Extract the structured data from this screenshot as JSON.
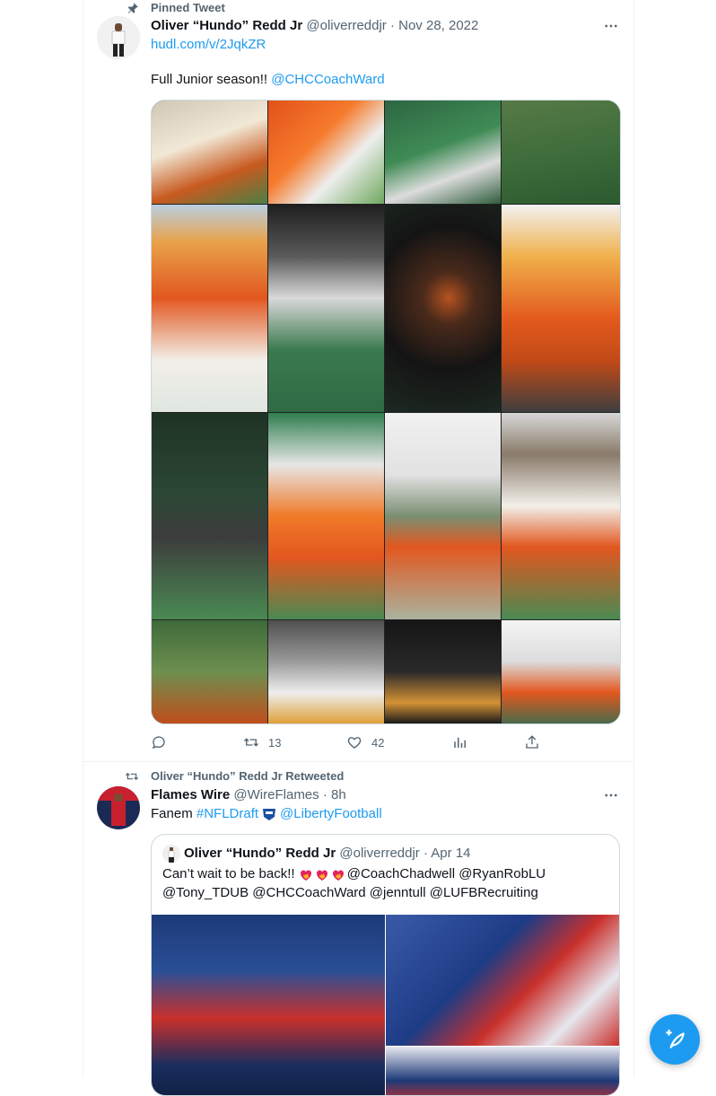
{
  "pinned_label": "Pinned Tweet",
  "tweet1": {
    "name": "Oliver “Hundo” Redd Jr",
    "handle": "@oliverreddjr",
    "date": "· Nov 28, 2022",
    "link": "hudl.com/v/2JqkZR",
    "text_prefix": "Full Junior season!! ",
    "mention": "@CHCCoachWard",
    "retweets": "13",
    "likes": "42"
  },
  "retweet_label": "Oliver “Hundo” Redd Jr Retweeted",
  "tweet2": {
    "name": "Flames Wire",
    "handle": "@WireFlames",
    "time": "· 8h",
    "text_prefix": "Fanem ",
    "hashtag": "#NFLDraft",
    "mention": "@LibertyFootball"
  },
  "quoted": {
    "name": "Oliver “Hundo” Redd Jr",
    "handle": "@oliverreddjr",
    "date": "· Apr 14",
    "line1_prefix": "Can’t wait to be back!! ",
    "line1_mention": "@CoachChadwell @RyanRobLU",
    "line2": "@Tony_TDUB @CHCCoachWard @jenntull @LUFBRecruiting"
  },
  "icons": {
    "pin": "pin-icon",
    "more": "more-icon",
    "reply": "reply-icon",
    "retweet": "retweet-icon",
    "like": "like-icon",
    "views": "views-icon",
    "share": "share-icon",
    "compose": "compose-icon"
  },
  "colors": {
    "accent": "#1d9bf0",
    "text": "#0f1419",
    "muted": "#536471",
    "border": "#eff3f4"
  }
}
